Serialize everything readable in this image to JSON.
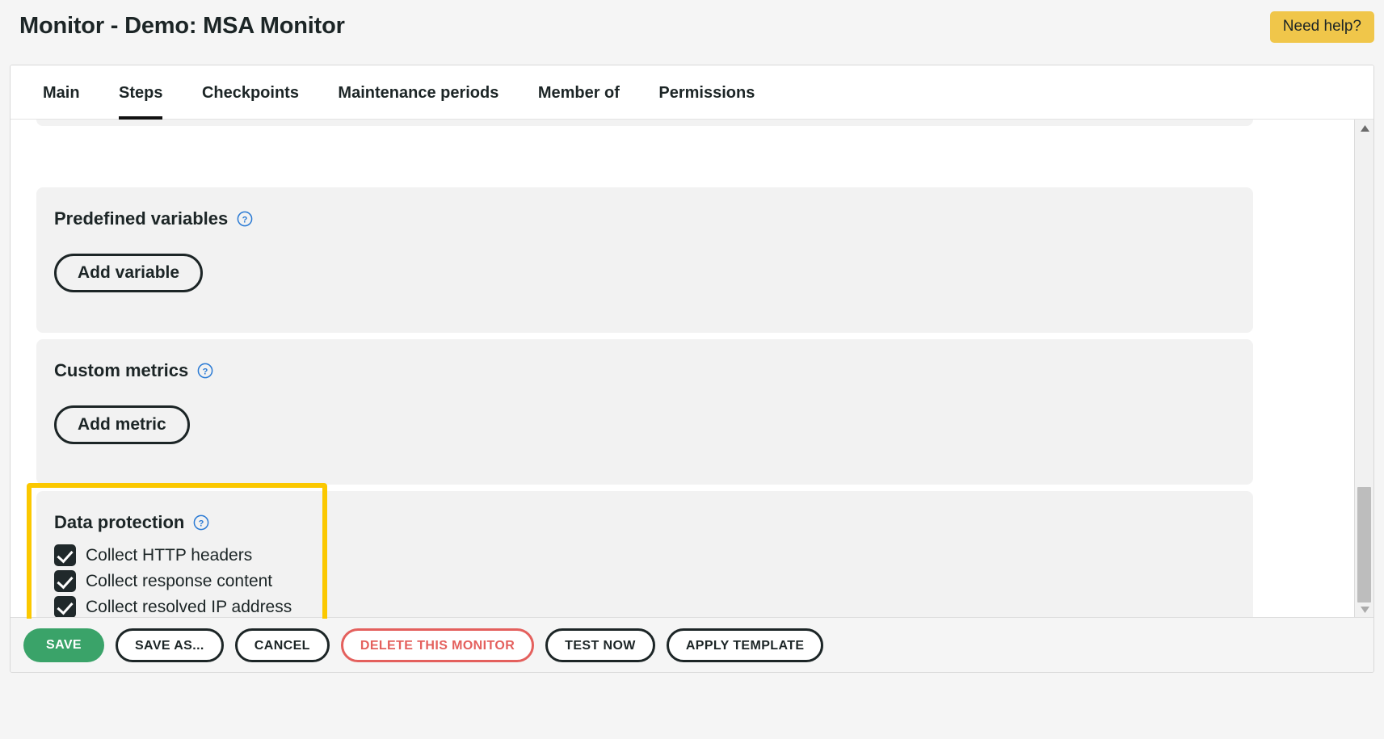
{
  "header": {
    "title": "Monitor - Demo: MSA Monitor",
    "need_help_label": "Need help?",
    "need_help_color": "#f0c64a"
  },
  "tabs": [
    {
      "label": "Main",
      "active": false
    },
    {
      "label": "Steps",
      "active": true
    },
    {
      "label": "Checkpoints",
      "active": false
    },
    {
      "label": "Maintenance periods",
      "active": false
    },
    {
      "label": "Member of",
      "active": false
    },
    {
      "label": "Permissions",
      "active": false
    }
  ],
  "sections": {
    "predefined_variables": {
      "title": "Predefined variables",
      "help_icon": "question-mark-circle-icon",
      "button_label": "Add variable"
    },
    "custom_metrics": {
      "title": "Custom metrics",
      "help_icon": "question-mark-circle-icon",
      "button_label": "Add metric"
    },
    "data_protection": {
      "title": "Data protection",
      "help_icon": "question-mark-circle-icon",
      "highlight_color": "#fbc800",
      "checkboxes": [
        {
          "label": "Collect HTTP headers",
          "checked": true
        },
        {
          "label": "Collect response content",
          "checked": true
        },
        {
          "label": "Collect resolved IP address",
          "checked": true
        }
      ]
    }
  },
  "footer": {
    "actions": [
      {
        "label": "SAVE",
        "style": "primary"
      },
      {
        "label": "SAVE AS...",
        "style": "outline"
      },
      {
        "label": "CANCEL",
        "style": "outline"
      },
      {
        "label": "DELETE THIS MONITOR",
        "style": "danger"
      },
      {
        "label": "TEST NOW",
        "style": "outline"
      },
      {
        "label": "APPLY TEMPLATE",
        "style": "outline"
      }
    ]
  },
  "scrollbar": {
    "up_arrow": "triangle-up-icon",
    "down_arrow": "triangle-down-icon"
  }
}
